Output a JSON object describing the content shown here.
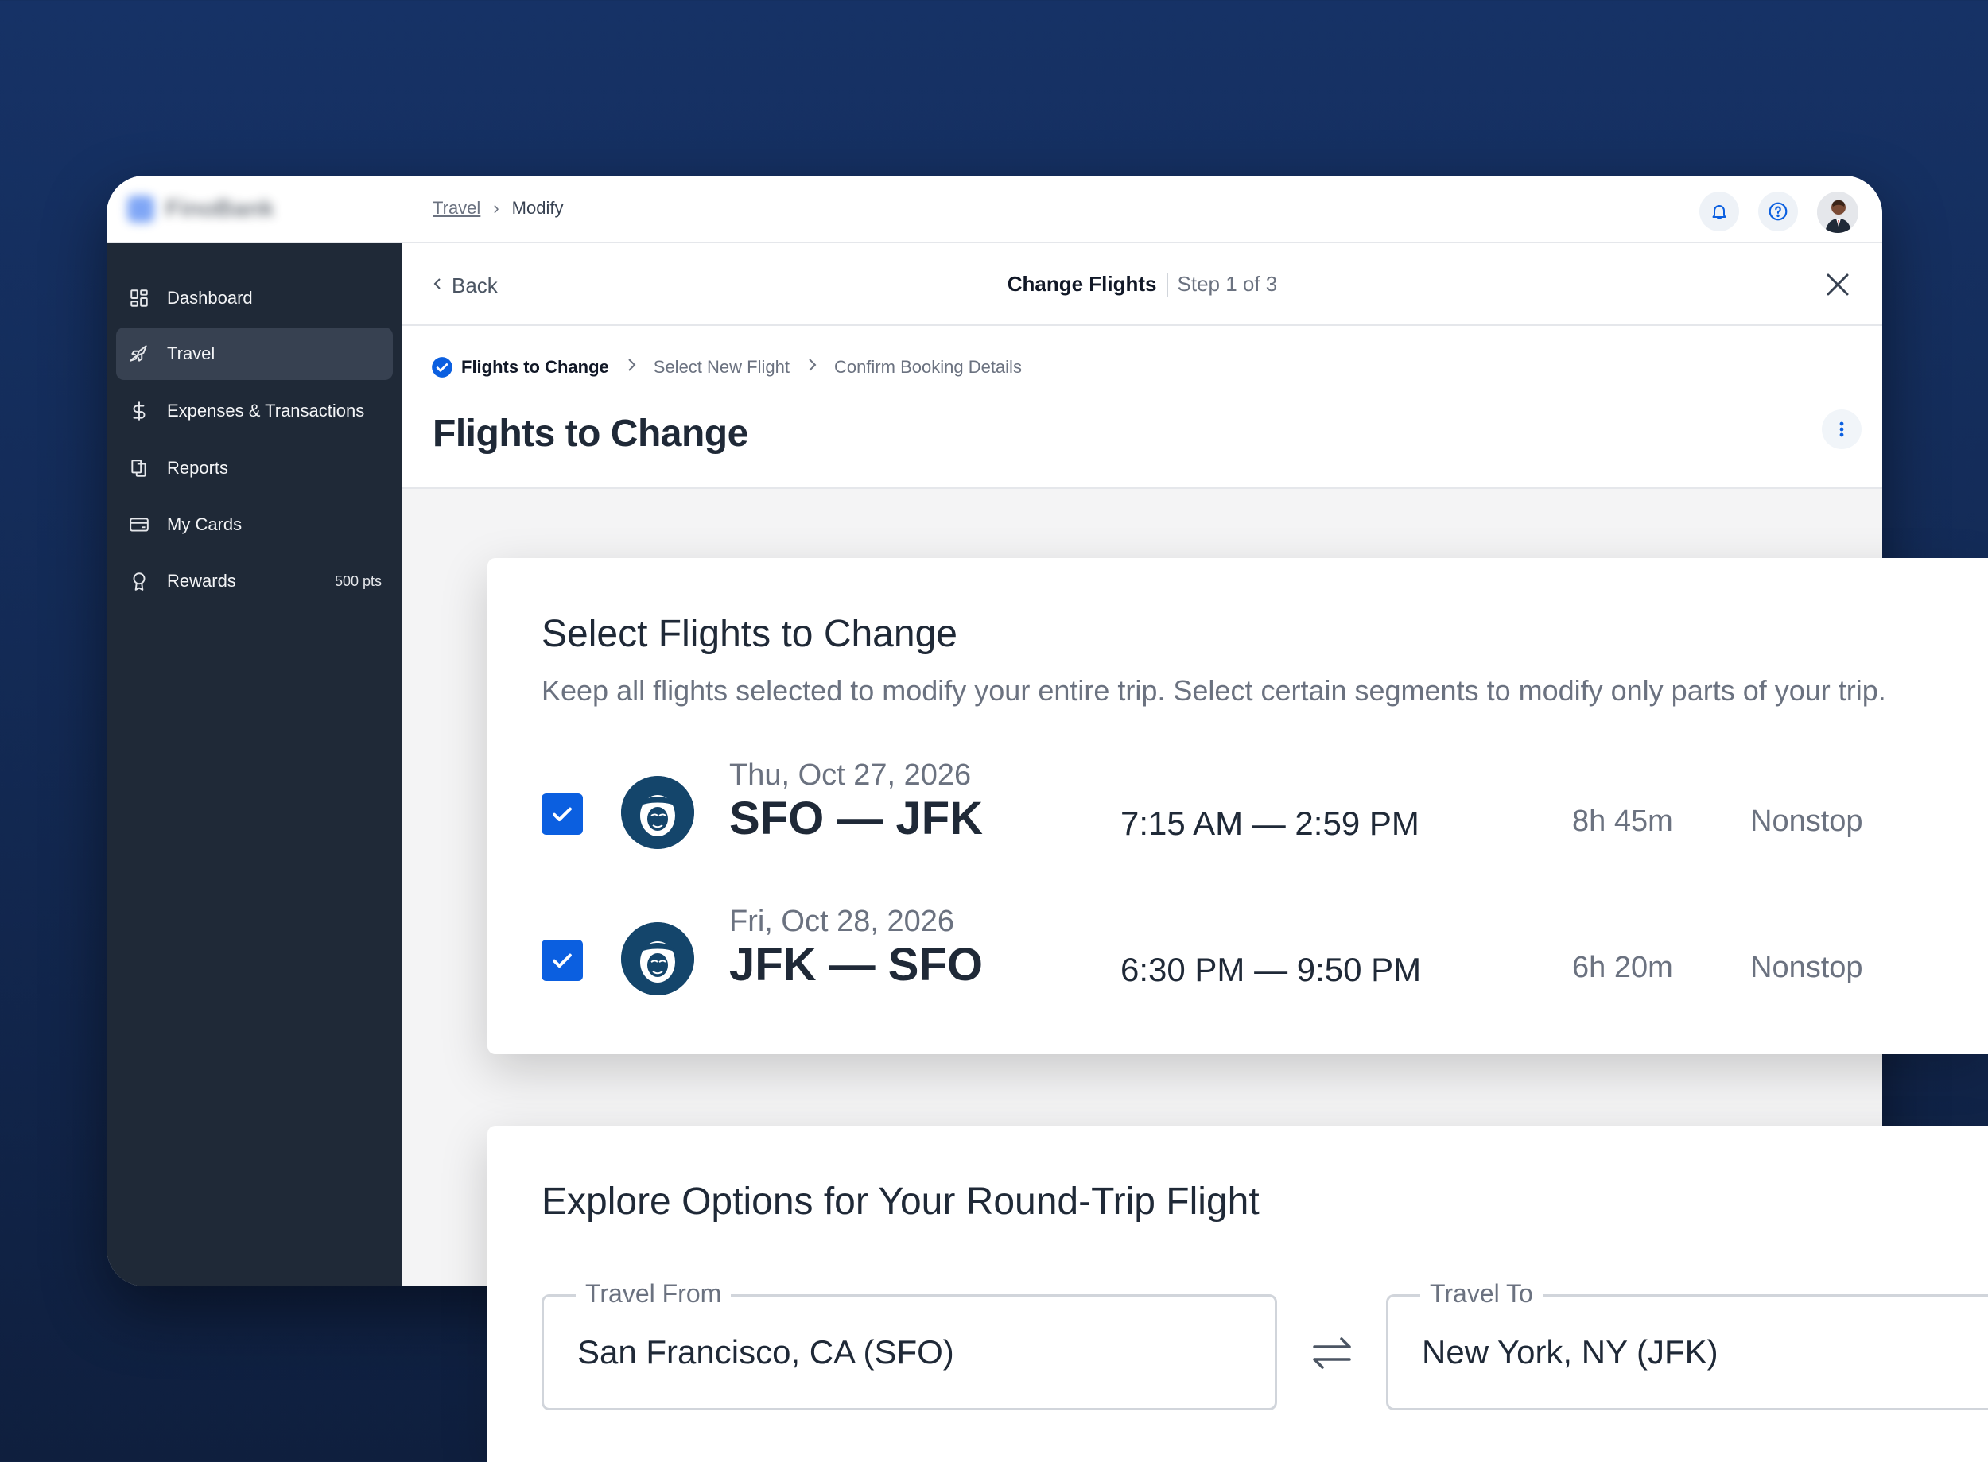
{
  "app": {
    "logo_text": "FinoBank"
  },
  "breadcrumb": {
    "link": "Travel",
    "current": "Modify"
  },
  "sidebar": {
    "items": [
      {
        "label": "Dashboard",
        "icon": "dashboard-icon"
      },
      {
        "label": "Travel",
        "icon": "plane-icon",
        "active": true
      },
      {
        "label": "Expenses & Transactions",
        "icon": "dollar-icon"
      },
      {
        "label": "Reports",
        "icon": "reports-icon"
      },
      {
        "label": "My Cards",
        "icon": "card-icon"
      },
      {
        "label": "Rewards",
        "icon": "award-icon",
        "badge": "500 pts"
      }
    ]
  },
  "header": {
    "back_label": "Back",
    "title": "Change Flights",
    "step": "Step 1 of 3"
  },
  "steps": [
    {
      "label": "Flights to Change",
      "status": "current"
    },
    {
      "label": "Select New Flight",
      "status": "upcoming"
    },
    {
      "label": "Confirm Booking Details",
      "status": "upcoming"
    }
  ],
  "page_title": "Flights to Change",
  "select_card": {
    "title": "Select Flights to Change",
    "subtitle": "Keep all flights selected to modify your entire trip. Select certain segments to modify only parts of your trip.",
    "flights": [
      {
        "date": "Thu, Oct 27, 2026",
        "route": "SFO — JFK",
        "time": "7:15 AM — 2:59 PM",
        "duration": "8h 45m",
        "stops": "Nonstop",
        "selected": true
      },
      {
        "date": "Fri, Oct 28, 2026",
        "route": "JFK — SFO",
        "time": "6:30 PM — 9:50 PM",
        "duration": "6h 20m",
        "stops": "Nonstop",
        "selected": true
      }
    ]
  },
  "explore_card": {
    "title": "Explore Options for Your Round-Trip Flight",
    "from_label": "Travel From",
    "from_value": "San Francisco, CA (SFO)",
    "to_label": "Travel To",
    "to_value": "New York, NY (JFK)"
  },
  "colors": {
    "accent": "#0b5fe0",
    "sidebar_bg": "#1f2937",
    "background": "#163266"
  }
}
